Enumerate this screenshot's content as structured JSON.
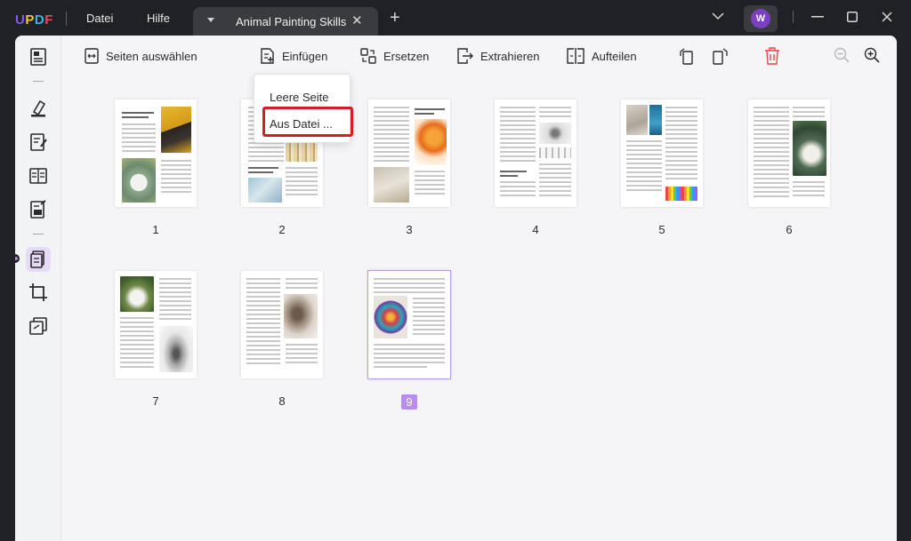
{
  "app": {
    "logo": "UPDF",
    "menus": [
      "Datei",
      "Hilfe"
    ],
    "tab_title": "Animal Painting Skills",
    "avatar_initial": "W"
  },
  "toolbar": {
    "select_pages": "Seiten auswählen",
    "insert": "Einfügen",
    "replace": "Ersetzen",
    "extract": "Extrahieren",
    "split": "Aufteilen"
  },
  "dropdown": {
    "items": [
      "Leere Seite",
      "Aus Datei ..."
    ]
  },
  "pages": [
    {
      "number": "1"
    },
    {
      "number": "2"
    },
    {
      "number": "3"
    },
    {
      "number": "4"
    },
    {
      "number": "5"
    },
    {
      "number": "6"
    },
    {
      "number": "7"
    },
    {
      "number": "8"
    },
    {
      "number": "9",
      "selected": true
    }
  ],
  "colors": {
    "accent": "#b98df0",
    "highlight": "#d71a28",
    "delete": "#e8454f",
    "avatar": "#7c3fc2"
  }
}
